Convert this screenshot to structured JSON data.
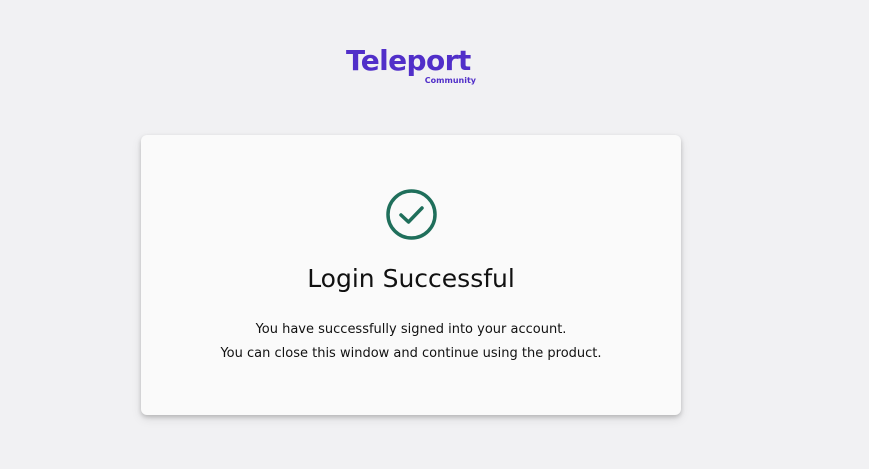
{
  "brand": {
    "name": "Teleport",
    "edition": "Community",
    "color": "#512fc9"
  },
  "status": {
    "icon": "check-circle-icon",
    "icon_color": "#1f6f5b",
    "title": "Login Successful",
    "message_line1": "You have successfully signed into your account.",
    "message_line2": "You can close this window and continue using the product."
  }
}
